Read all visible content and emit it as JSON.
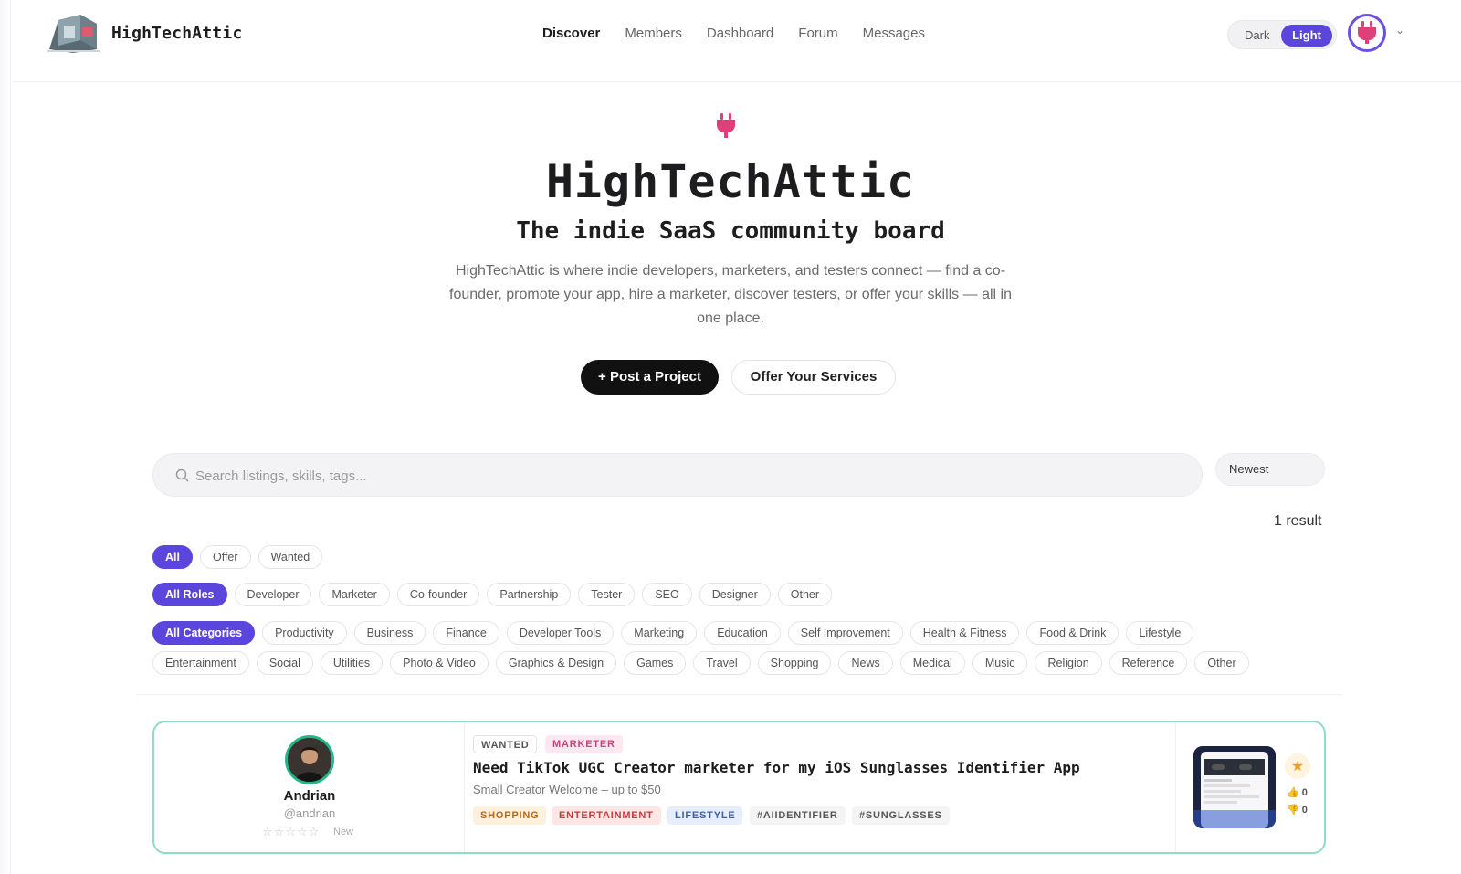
{
  "header": {
    "brand": "HighTechAttic",
    "nav": [
      {
        "label": "Discover",
        "active": true
      },
      {
        "label": "Members",
        "active": false
      },
      {
        "label": "Dashboard",
        "active": false
      },
      {
        "label": "Forum",
        "active": false
      },
      {
        "label": "Messages",
        "active": false
      }
    ],
    "theme": {
      "dark_label": "Dark",
      "light_label": "Light",
      "selected": "Light"
    },
    "avatar_icon": "plug-icon",
    "menu_icon": "chevron-down-icon"
  },
  "hero": {
    "icon": "plug-icon",
    "title": "HighTechAttic",
    "subtitle": "The indie SaaS community board",
    "description": "HighTechAttic is where indie developers, marketers, and testers connect — find a co-founder, promote your app, hire a marketer, discover testers, or offer your skills — all in one place.",
    "primary_button": "+ Post a Project",
    "secondary_button": "Offer Your Services"
  },
  "search": {
    "placeholder": "Search listings, skills, tags...",
    "value": "",
    "sort_label": "Newest",
    "results_text": "1 result"
  },
  "filters": {
    "types": [
      "All",
      "Offer",
      "Wanted"
    ],
    "types_active": "All",
    "roles": [
      "All Roles",
      "Developer",
      "Marketer",
      "Co-founder",
      "Partnership",
      "Tester",
      "SEO",
      "Designer",
      "Other"
    ],
    "roles_active": "All Roles",
    "categories_row1": [
      "All Categories",
      "Productivity",
      "Business",
      "Finance",
      "Developer Tools",
      "Marketing",
      "Education",
      "Self Improvement",
      "Health & Fitness",
      "Food & Drink",
      "Lifestyle"
    ],
    "categories_row2": [
      "Entertainment",
      "Social",
      "Utilities",
      "Photo & Video",
      "Graphics & Design",
      "Games",
      "Travel",
      "Shopping",
      "News",
      "Medical",
      "Music",
      "Religion",
      "Reference",
      "Other"
    ],
    "categories_active": "All Categories"
  },
  "listing": {
    "user": {
      "name": "Andrian",
      "handle": "@andrian",
      "rating_text": "New",
      "stars": 0
    },
    "tags_top": [
      {
        "label": "WANTED",
        "bg": "#ffffff",
        "color": "#555555",
        "border": "#e3e3e3"
      },
      {
        "label": "MARKETER",
        "bg": "#fde8f1",
        "color": "#c2487a",
        "border": "#fde8f1"
      }
    ],
    "title": "Need TikTok UGC Creator marketer for my iOS Sunglasses Identifier App",
    "meta": "Small Creator Welcome – up to $50",
    "tags_bottom": [
      {
        "label": "SHOPPING",
        "bg": "#fdf0dc",
        "color": "#b86a12"
      },
      {
        "label": "ENTERTAINMENT",
        "bg": "#fde6e6",
        "color": "#c53b3b"
      },
      {
        "label": "LIFESTYLE",
        "bg": "#e6eefc",
        "color": "#3d5ea8"
      },
      {
        "label": "#AIIDENTIFIER",
        "bg": "#f4f4f5",
        "color": "#555555"
      },
      {
        "label": "#SUNGLASSES",
        "bg": "#f4f4f5",
        "color": "#555555"
      }
    ],
    "upvotes": "0",
    "downvotes": "0",
    "accent": "#8fdcc4"
  },
  "colors": {
    "accent": "#5b46dd",
    "brand_pink": "#e0407a"
  }
}
